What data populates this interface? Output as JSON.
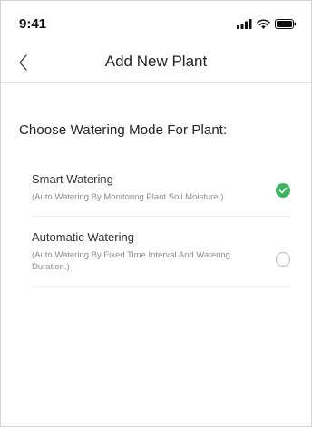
{
  "status_bar": {
    "time": "9:41",
    "icons": [
      "signal-icon",
      "wifi-icon",
      "battery-icon"
    ]
  },
  "nav": {
    "title": "Add New Plant",
    "back_icon": "chevron-left-icon"
  },
  "section": {
    "heading": "Choose Watering Mode For Plant:"
  },
  "options": [
    {
      "title": "Smart Watering",
      "description": "(Auto Watering By Monitoring Plant Soil Moisture.)",
      "selected": true
    },
    {
      "title": "Automatic Watering",
      "description": "(Auto Watering By Fixed Time Interval And Watering Duration.)",
      "selected": false
    }
  ],
  "colors": {
    "accent": "#3ab45e",
    "divider": "#ececec",
    "secondary_text": "#8c8c8c"
  }
}
